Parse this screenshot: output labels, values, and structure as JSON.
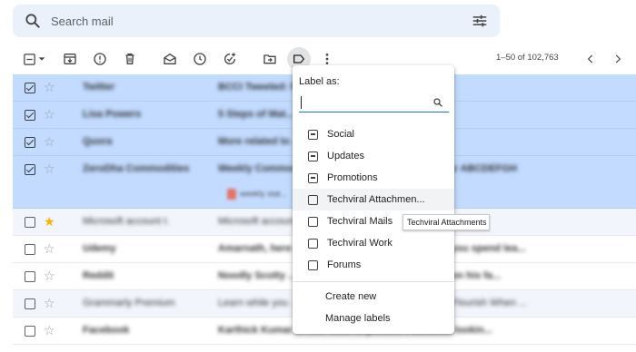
{
  "search": {
    "placeholder": "Search mail"
  },
  "toolbar": {
    "range_text": "1–50 of 102,763"
  },
  "emails": [
    {
      "sender": "Twitter",
      "subject": "BCCI Tweeted: Request for Prop...",
      "selected": true,
      "starred": false
    },
    {
      "sender": "Lisa Powers",
      "subject": "5 Steps of Mat...",
      "selected": true,
      "starred": false
    },
    {
      "sender": "Quora",
      "subject": "More related to ... ...ood life is Vedic astrology?",
      "selected": true,
      "starred": false
    },
    {
      "sender": "ZeroDha Commodities",
      "subject": "Weekly Commodity ... 2022/04/18 - 2022/04/23 Dear ABCDEFGH",
      "selected": true,
      "starred": false,
      "attachment": "weekly stat..."
    },
    {
      "sender": "Microsoft account t.",
      "subject": "Microsoft account ... Please use the following sec...",
      "selected": false,
      "starred": true
    },
    {
      "sender": "Udemy",
      "subject": "Amarnath, here are ... ...rds the result of the time you spend lea...",
      "selected": false,
      "starred": false
    },
    {
      "sender": "Reddit",
      "subject": "Noodly Scotty ... ...ternalAdoption: Scotty Scotty on his fa...",
      "selected": false,
      "starred": false
    },
    {
      "sender": "Grammarly Premium",
      "subject": "Learn while you ... ...l to read today. Let Your Writing Flourish When ...",
      "selected": false,
      "starred": false
    },
    {
      "sender": "Facebook",
      "subject": "Karthick Kumar ... ...ve what to predict. Facebook lookin...",
      "selected": false,
      "starred": false
    }
  ],
  "label_menu": {
    "title": "Label as:",
    "search_value": "",
    "labels": [
      {
        "name": "Social",
        "state": "indeterminate"
      },
      {
        "name": "Updates",
        "state": "indeterminate"
      },
      {
        "name": "Promotions",
        "state": "indeterminate"
      },
      {
        "name": "Techviral Attachmen...",
        "state": "unchecked"
      },
      {
        "name": "Techviral Mails",
        "state": "unchecked"
      },
      {
        "name": "Techviral Work",
        "state": "unchecked"
      },
      {
        "name": "Forums",
        "state": "unchecked"
      }
    ],
    "create_new": "Create new",
    "manage_labels": "Manage labels"
  },
  "tooltip": {
    "text": "Techviral Attachments"
  },
  "colors": {
    "selected_row": "#c2dbff",
    "search_bg": "#eaf1fb",
    "accent": "#1a73e8",
    "star": "#f4b400"
  }
}
